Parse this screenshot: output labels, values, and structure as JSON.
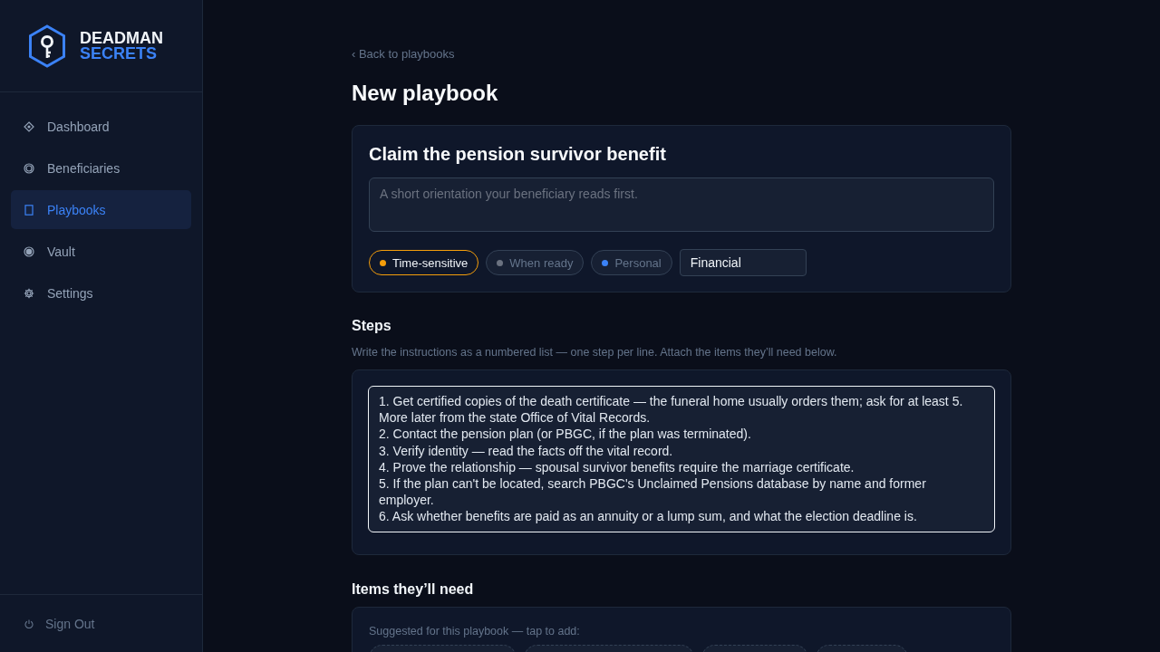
{
  "sidebar": {
    "logo": {
      "line_1": "DEADMAN",
      "line_2": "SECRETS"
    },
    "nav_items": [
      {
        "label": "Dashboard",
        "selected": false
      },
      {
        "label": "Beneficiaries",
        "selected": false
      },
      {
        "label": "Playbooks",
        "selected": true
      },
      {
        "label": "Vault",
        "selected": false
      },
      {
        "label": "Settings",
        "selected": false
      }
    ],
    "sign_out": "Sign Out"
  },
  "back_link": "‹ Back to playbooks",
  "page_title": "New playbook",
  "playbook_card": {
    "title": "Claim the pension survivor benefit",
    "summary": {
      "placeholder": "A short orientation your beneficiary reads first."
    },
    "priorities": [
      {
        "label": "Time-sensitive",
        "color": "#f59e0b",
        "selected": true
      },
      {
        "label": "When ready",
        "color": "#6b7280",
        "selected": false
      },
      {
        "label": "Personal",
        "color": "#3b82f6",
        "selected": false
      }
    ],
    "category": {
      "value": "Financial"
    }
  },
  "steps": {
    "heading": "Steps",
    "hint": "Write the instructions as a numbered list — one step per line. Attach the items they’ll need below.",
    "value": "1. Get certified copies of the death certificate — the funeral home usually orders them; ask for at least 5. More later from the state Office of Vital Records.\n2. Contact the pension plan (or PBGC, if the plan was terminated).\n3. Verify identity — read the facts off the vital record.\n4. Prove the relationship — spousal survivor benefits require the marriage certificate.\n5. If the plan can't be located, search PBGC's Unclaimed Pensions database by name and former employer.\n6. Ask whether benefits are paid as an annuity or a lump sum, and what the election deadline is."
  },
  "items": {
    "heading": "Items they’ll need",
    "hint": "Suggested for this playbook — tap to add:",
    "suggestions": [
      {
        "selected": false
      },
      {
        "selected": false
      },
      {
        "selected": false
      },
      {
        "selected": false
      }
    ]
  }
}
